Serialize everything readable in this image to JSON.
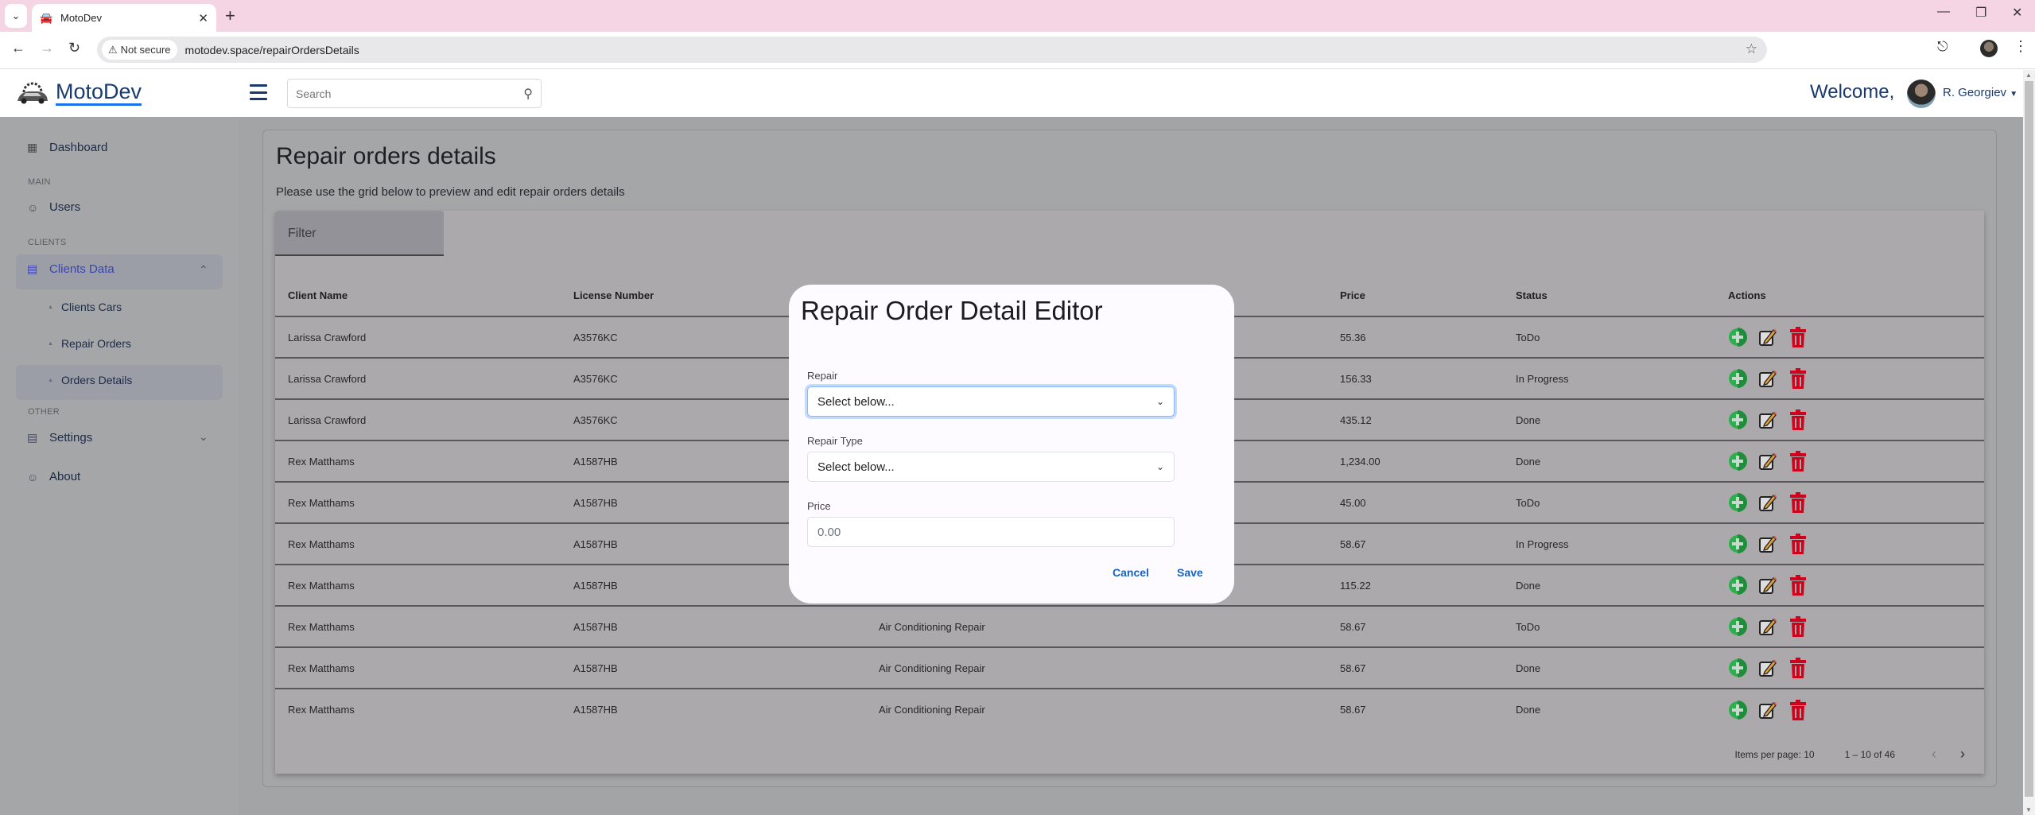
{
  "browser": {
    "tab_title": "MotoDev",
    "security_label": "Not secure",
    "url": "motodev.space/repairOrdersDetails"
  },
  "header": {
    "logo_text": "MotoDev",
    "search_placeholder": "Search",
    "welcome": "Welcome,",
    "user_name": "R. Georgiev"
  },
  "sidebar": {
    "dashboard": "Dashboard",
    "section_main": "MAIN",
    "users": "Users",
    "section_clients": "CLIENTS",
    "clients_data": "Clients Data",
    "sub_items": [
      "Clients Cars",
      "Repair Orders",
      "Orders Details"
    ],
    "section_other": "OTHER",
    "settings": "Settings",
    "about": "About"
  },
  "page": {
    "title": "Repair orders details",
    "subtitle": "Please use the grid below to preview and edit repair orders details",
    "filter_label": "Filter"
  },
  "table": {
    "columns": [
      "Client Name",
      "License Number",
      "",
      "Price",
      "Status",
      "Actions"
    ],
    "rows": [
      {
        "client": "Larissa Crawford",
        "license": "A3576KC",
        "repair": "",
        "price": "55.36",
        "status": "ToDo"
      },
      {
        "client": "Larissa Crawford",
        "license": "A3576KC",
        "repair": "",
        "price": "156.33",
        "status": "In Progress"
      },
      {
        "client": "Larissa Crawford",
        "license": "A3576KC",
        "repair": "",
        "price": "435.12",
        "status": "Done"
      },
      {
        "client": "Rex Matthams",
        "license": "A1587HB",
        "repair": "",
        "price": "1,234.00",
        "status": "Done"
      },
      {
        "client": "Rex Matthams",
        "license": "A1587HB",
        "repair": "",
        "price": "45.00",
        "status": "ToDo"
      },
      {
        "client": "Rex Matthams",
        "license": "A1587HB",
        "repair": "",
        "price": "58.67",
        "status": "In Progress"
      },
      {
        "client": "Rex Matthams",
        "license": "A1587HB",
        "repair": "",
        "price": "115.22",
        "status": "Done"
      },
      {
        "client": "Rex Matthams",
        "license": "A1587HB",
        "repair": "Air Conditioning Repair",
        "price": "58.67",
        "status": "ToDo"
      },
      {
        "client": "Rex Matthams",
        "license": "A1587HB",
        "repair": "Air Conditioning Repair",
        "price": "58.67",
        "status": "Done"
      },
      {
        "client": "Rex Matthams",
        "license": "A1587HB",
        "repair": "Air Conditioning Repair",
        "price": "58.67",
        "status": "Done"
      }
    ],
    "action_icons": [
      "add-circle-icon",
      "edit-pencil-icon",
      "trash-icon"
    ]
  },
  "pagination": {
    "items_per_page": "Items per page: 10",
    "range": "1 – 10 of 46"
  },
  "modal": {
    "title": "Repair Order Detail Editor",
    "repair_label": "Repair",
    "repair_value": "Select below...",
    "repair_type_label": "Repair Type",
    "repair_type_value": "Select below...",
    "price_label": "Price",
    "price_placeholder": "0.00",
    "cancel": "Cancel",
    "save": "Save"
  },
  "colors": {
    "brand": "#1a3a6e",
    "link_blue": "#1565c0",
    "add_green": "#2eae4e",
    "delete_red": "#d0021b"
  }
}
